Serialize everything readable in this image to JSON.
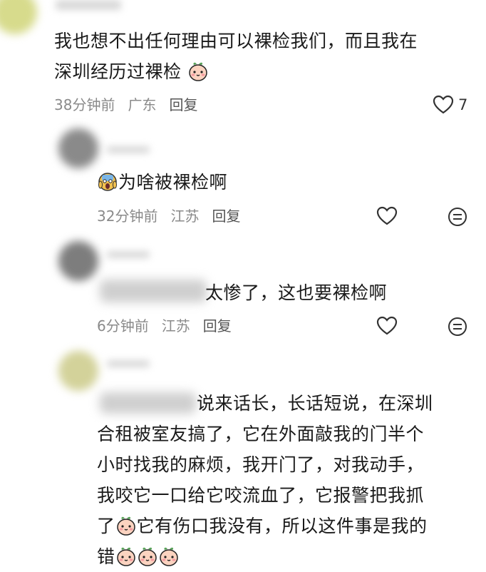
{
  "comments": [
    {
      "text_a": "我也想不出任何理由可以裸检我们，而且我在",
      "text_b": "深圳经历过裸检",
      "time": "38分钟前",
      "location": "广东",
      "reply_label": "回复",
      "likes": "7",
      "avatar_color": "#c9d47a"
    },
    {
      "text": "为啥被裸检啊",
      "time": "32分钟前",
      "location": "江苏",
      "reply_label": "回复",
      "avatar_color": "#8d8d8d"
    },
    {
      "text": "太惨了，这也要裸检啊",
      "time": "6分钟前",
      "location": "江苏",
      "reply_label": "回复",
      "avatar_color": "#7e7e7e"
    },
    {
      "line1": "说来话长，长话短说，在深圳",
      "line2": "合租被室友搞了，它在外面敲我的门半个",
      "line3": "小时找我的麻烦，我开门了，对我动手，",
      "line4": "我咬它一口给它咬流血了，它报警把我抓",
      "line5_a": "了",
      "line5_b": "它有伤口我没有，所以这件事是我的",
      "line6": "错",
      "avatar_color": "#d6d59a"
    }
  ],
  "icons": {
    "heart": "heart-outline-icon",
    "comment": "comment-smile-icon",
    "face": "peach-face-emoji",
    "scream": "scream-emoji"
  }
}
